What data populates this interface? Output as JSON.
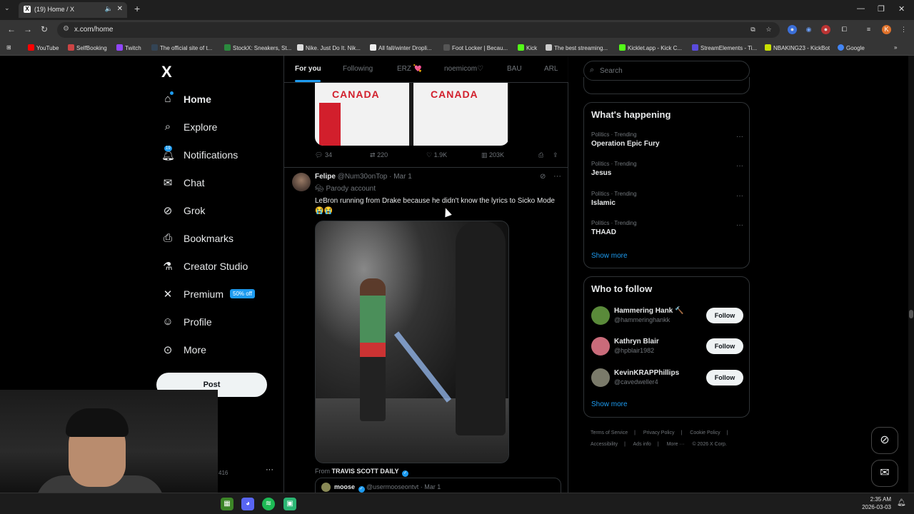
{
  "browser": {
    "tab_title": "(19) Home / X",
    "tab_favicon": "X",
    "url": "x.com/home",
    "profile_initial": "K",
    "bookmarks": [
      "YouTube",
      "SelfBooking",
      "Twitch",
      "The official site of t...",
      "StockX: Sneakers, St...",
      "Nike. Just Do It. Nik...",
      "All fall/winter Dropli...",
      "Foot Locker | Becau...",
      "Kick",
      "The best streaming...",
      "Kicklet.app - Kick C...",
      "StreamElements - Ti...",
      "NBAKING23 - KickBot",
      "Google"
    ]
  },
  "sidebar": {
    "logo": "X",
    "items": [
      {
        "label": "Home",
        "icon": "home-icon"
      },
      {
        "label": "Explore",
        "icon": "search-icon"
      },
      {
        "label": "Notifications",
        "icon": "bell-icon",
        "badge": "19"
      },
      {
        "label": "Chat",
        "icon": "mail-icon"
      },
      {
        "label": "Grok",
        "icon": "grok-icon"
      },
      {
        "label": "Bookmarks",
        "icon": "bookmark-icon"
      },
      {
        "label": "Creator Studio",
        "icon": "creator-icon"
      },
      {
        "label": "Premium",
        "icon": "x-icon",
        "badge": "50% off"
      },
      {
        "label": "Profile",
        "icon": "person-icon"
      },
      {
        "label": "More",
        "icon": "more-circle-icon"
      }
    ],
    "post_label": "Post",
    "user_stub": "416",
    "user_more": "···"
  },
  "timeline": {
    "tabs": [
      "For you",
      "Following",
      "ERZ 💘",
      "noemicom♡",
      "BAU",
      "ARL"
    ],
    "prev_post": {
      "jersey_text": "CANADA",
      "replies": "34",
      "reposts": "220",
      "likes": "1.9K",
      "views": "203K"
    },
    "post": {
      "name": "Felipe",
      "handle": "@Num30onTop",
      "date": "· Mar 1",
      "parody": "Parody account",
      "text": "LeBron running from Drake because he didn't know the lyrics to Sicko Mode 😭😭",
      "from_label": "From",
      "from_source": "TRAVIS SCOTT DAILY",
      "quote_name": "moose",
      "quote_handle": "@usermooseontvt · Mar 1"
    }
  },
  "right": {
    "search_placeholder": "Search",
    "whats_happening": "What's happening",
    "trends": [
      {
        "meta": "Politics · Trending",
        "name": "Operation Epic Fury"
      },
      {
        "meta": "Politics · Trending",
        "name": "Jesus"
      },
      {
        "meta": "Politics · Trending",
        "name": "Islamic"
      },
      {
        "meta": "Politics · Trending",
        "name": "THAAD"
      }
    ],
    "show_more": "Show more",
    "who_to_follow": "Who to follow",
    "follows": [
      {
        "name": "Hammering Hank 🔨",
        "handle": "@hammeringhankk",
        "color": "#5a8a3a"
      },
      {
        "name": "Kathryn Blair",
        "handle": "@hpblair1982",
        "color": "#c96b7a"
      },
      {
        "name": "KevinKRAPPhillips",
        "handle": "@cavedweller4",
        "color": "#7a7a6a"
      }
    ],
    "follow_label": "Follow",
    "footer": [
      "Terms of Service",
      "|",
      "Privacy Policy",
      "|",
      "Cookie Policy",
      "|",
      "Accessibility",
      "|",
      "Ads info",
      "|",
      "More ···",
      "© 2026 X Corp."
    ]
  },
  "taskbar": {
    "time": "2:35 AM",
    "date": "2026-03-03"
  },
  "colors": {
    "accent": "#1d9bf0",
    "background": "#000000"
  }
}
